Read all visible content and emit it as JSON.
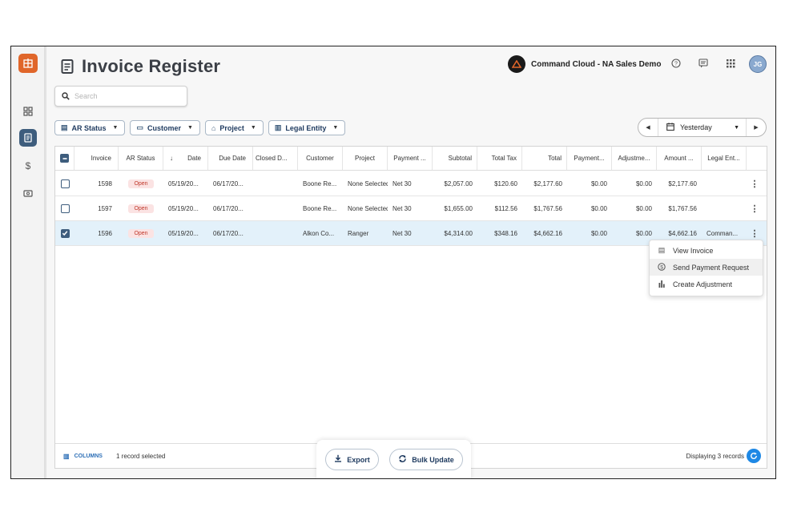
{
  "header": {
    "title": "Invoice Register",
    "brand": "Command Cloud - NA Sales Demo",
    "avatar_initials": "JG"
  },
  "search": {
    "placeholder": "Search"
  },
  "filters": [
    {
      "label": "AR Status",
      "icon": "list-icon"
    },
    {
      "label": "Customer",
      "icon": "customer-icon"
    },
    {
      "label": "Project",
      "icon": "home-icon"
    },
    {
      "label": "Legal Entity",
      "icon": "building-icon"
    }
  ],
  "date_range": {
    "label": "Yesterday"
  },
  "table": {
    "columns": [
      "Invoice",
      "AR Status",
      "Date",
      "Due Date",
      "Closed D...",
      "Customer",
      "Project",
      "Payment ...",
      "Subtotal",
      "Total Tax",
      "Total",
      "Payment...",
      "Adjustme...",
      "Amount ...",
      "Legal Ent..."
    ],
    "rows": [
      {
        "invoice": "1598",
        "status": "Open",
        "date": "05/19/20...",
        "due": "06/17/20...",
        "closed": "",
        "customer": "Boone Re...",
        "project": "None Selected",
        "terms": "Net 30",
        "subtotal": "$2,057.00",
        "tax": "$120.60",
        "total": "$2,177.60",
        "payments": "$0.00",
        "adjustments": "$0.00",
        "amount": "$2,177.60",
        "entity": "",
        "selected": false
      },
      {
        "invoice": "1597",
        "status": "Open",
        "date": "05/19/20...",
        "due": "06/17/20...",
        "closed": "",
        "customer": "Boone Re...",
        "project": "None Selected",
        "terms": "Net 30",
        "subtotal": "$1,655.00",
        "tax": "$112.56",
        "total": "$1,767.56",
        "payments": "$0.00",
        "adjustments": "$0.00",
        "amount": "$1,767.56",
        "entity": "",
        "selected": false
      },
      {
        "invoice": "1596",
        "status": "Open",
        "date": "05/19/20...",
        "due": "06/17/20...",
        "closed": "",
        "customer": "Alkon Co...",
        "project": "Ranger",
        "terms": "Net 30",
        "subtotal": "$4,314.00",
        "tax": "$348.16",
        "total": "$4,662.16",
        "payments": "$0.00",
        "adjustments": "$0.00",
        "amount": "$4,662.16",
        "entity": "Comman...",
        "selected": true
      }
    ]
  },
  "context_menu": [
    "View Invoice",
    "Send Payment Request",
    "Create Adjustment"
  ],
  "footer": {
    "columns_label": "COLUMNS",
    "selection": "1 record selected",
    "displaying": "Displaying 3 records"
  },
  "actions": {
    "export": "Export",
    "bulk_update": "Bulk Update"
  },
  "colors": {
    "accent": "#3e5d7d",
    "brand_orange": "#e0662a",
    "selected_row": "#e3f1fa",
    "status_open_bg": "#fbe3e3",
    "status_open_fg": "#c0392b",
    "refresh": "#1e88e5"
  }
}
